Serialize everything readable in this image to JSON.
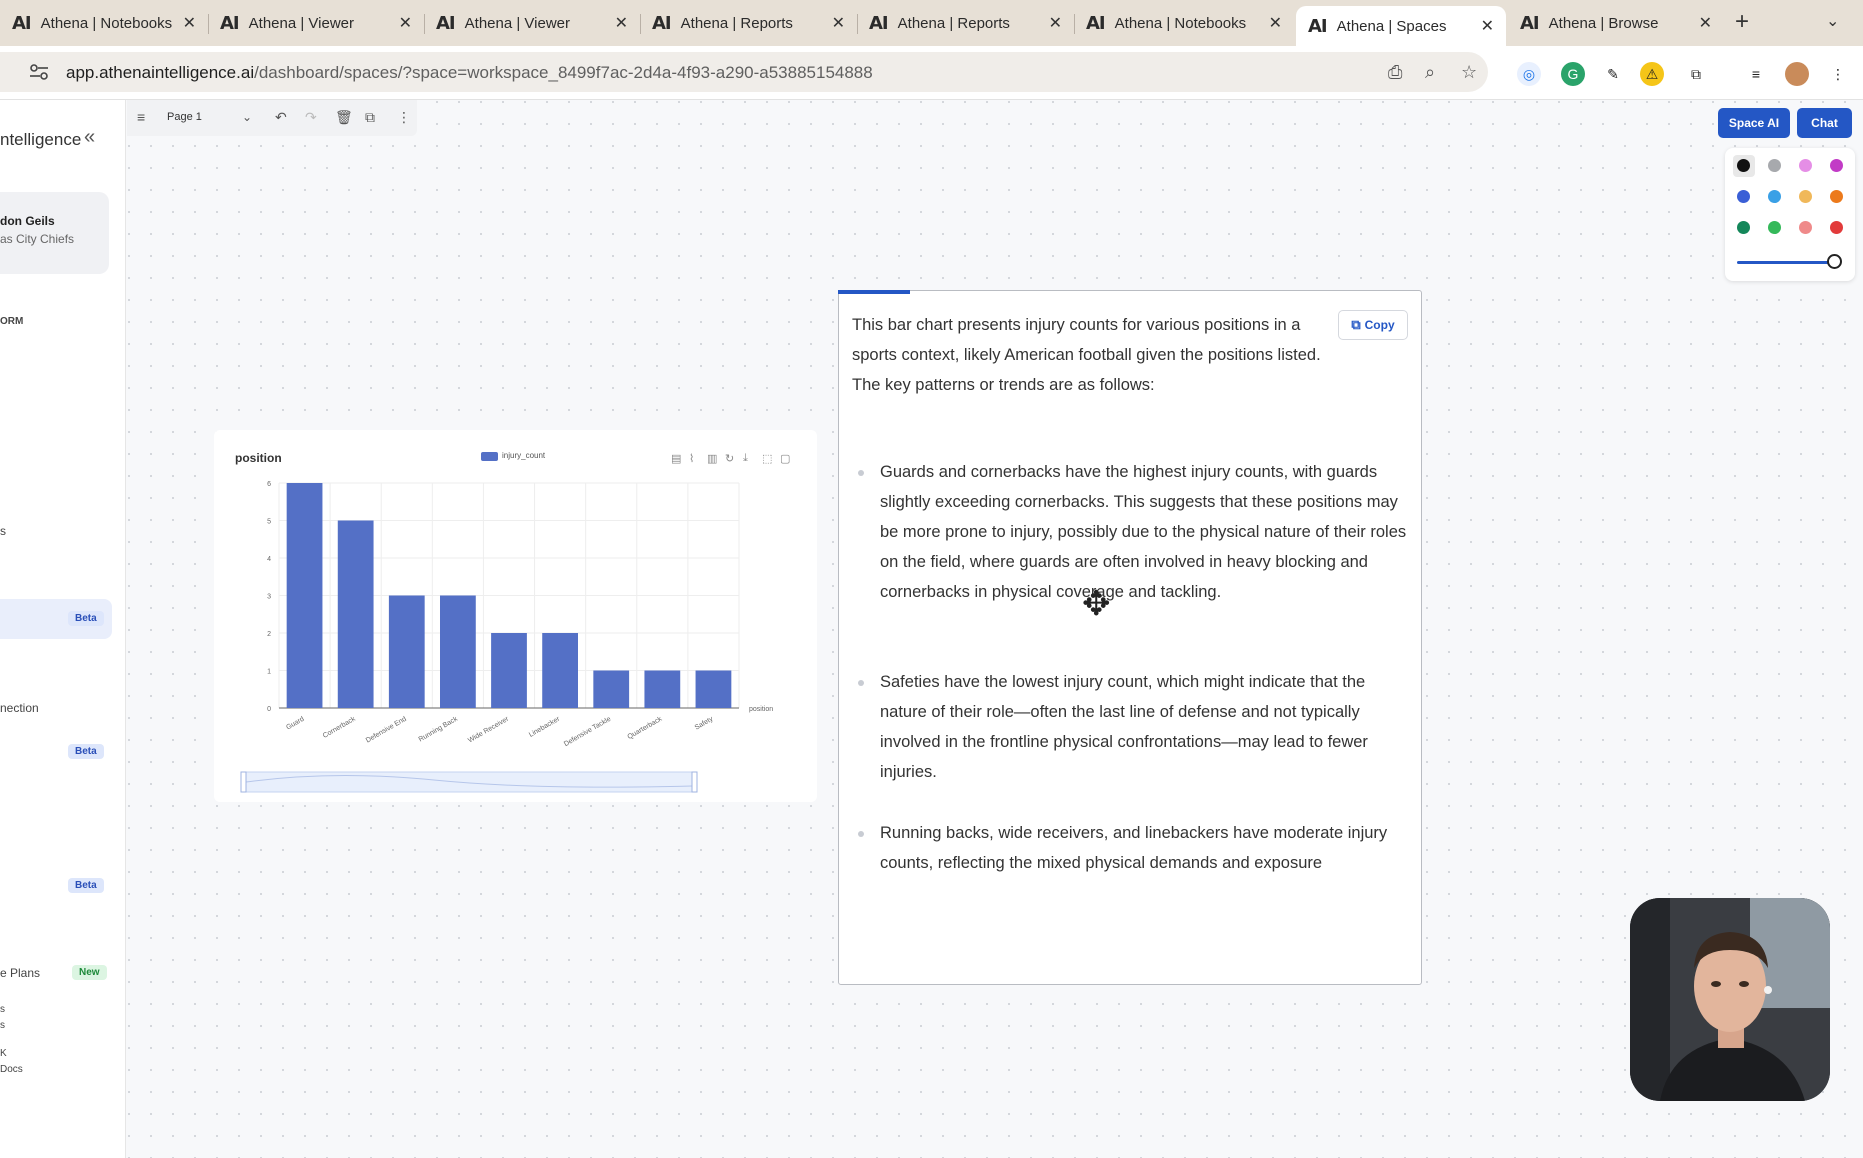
{
  "browser": {
    "tabs": [
      {
        "title": "Athena | Notebooks",
        "active": false
      },
      {
        "title": "Athena | Viewer",
        "active": false
      },
      {
        "title": "Athena | Viewer",
        "active": false
      },
      {
        "title": "Athena | Reports",
        "active": false
      },
      {
        "title": "Athena | Reports",
        "active": false
      },
      {
        "title": "Athena | Notebooks",
        "active": false
      },
      {
        "title": "Athena | Spaces",
        "active": true
      },
      {
        "title": "Athena | Browse",
        "active": false
      }
    ],
    "tab_logo": "AI",
    "new_tab": "+",
    "url_host": "app.athenaintelligence.ai",
    "url_path": "/dashboard/spaces/?space=workspace_8499f7ac-2d4a-4f93-a290-a53885154888"
  },
  "sidebar": {
    "brand": "ntelligence",
    "user_name": "don Geils",
    "user_team": "as City Chiefs",
    "section_label": "ORM",
    "items": [
      {
        "label": "s"
      },
      {
        "label": "nection"
      },
      {
        "label": "e Plans"
      },
      {
        "label": "s"
      },
      {
        "label": "s"
      },
      {
        "label": "K"
      },
      {
        "label": "Docs"
      }
    ],
    "badges": [
      "Beta",
      "Beta",
      "Beta",
      "New"
    ]
  },
  "page_toolbar": {
    "page_label": "Page 1"
  },
  "actions": {
    "space_ai": "Space AI",
    "chat": "Chat"
  },
  "palette": {
    "colors": [
      "#111111",
      "#a7a9ad",
      "#e58ee6",
      "#c23bc6",
      "#3a5fd6",
      "#3aa0e6",
      "#f0b85a",
      "#ec7a1c",
      "#14875a",
      "#35b95a",
      "#ef8a8a",
      "#e23b3b"
    ],
    "stroke_level": 1.0
  },
  "chart_data": {
    "type": "bar",
    "title": "position",
    "xlabel": "position",
    "ylabel": "",
    "legend": [
      "injury_count"
    ],
    "categories": [
      "Guard",
      "Cornerback",
      "Defensive End",
      "Running Back",
      "Wide Receiver",
      "Linebacker",
      "Defensive Tackle",
      "Quarterback",
      "Safety"
    ],
    "series": [
      {
        "name": "injury_count",
        "values": [
          6,
          5,
          3,
          3,
          2,
          2,
          1,
          1,
          1
        ]
      }
    ],
    "yticks": [
      "0",
      "1",
      "2",
      "3",
      "4",
      "5",
      "6"
    ],
    "ylim": [
      0,
      6
    ],
    "color": "#5470c6",
    "grid": true,
    "legend_position": "top-center"
  },
  "summary": {
    "copy_label": "Copy",
    "intro": "This bar chart presents injury counts for various positions in a sports context, likely American football given the positions listed. The key patterns or trends are as follows:",
    "bullets": [
      "Guards and cornerbacks have the highest injury counts, with guards slightly exceeding cornerbacks. This suggests that these positions may be more prone to injury, possibly due to the physical nature of their roles on the field, where guards are often involved in heavy blocking and cornerbacks in physical coverage and tackling.",
      "Safeties have the lowest injury count, which might indicate that the nature of their role—often the last line of defense and not typically involved in the frontline physical confrontations—may lead to fewer injuries.",
      "Running backs, wide receivers, and linebackers have moderate injury counts, reflecting the mixed physical demands and exposure"
    ]
  }
}
